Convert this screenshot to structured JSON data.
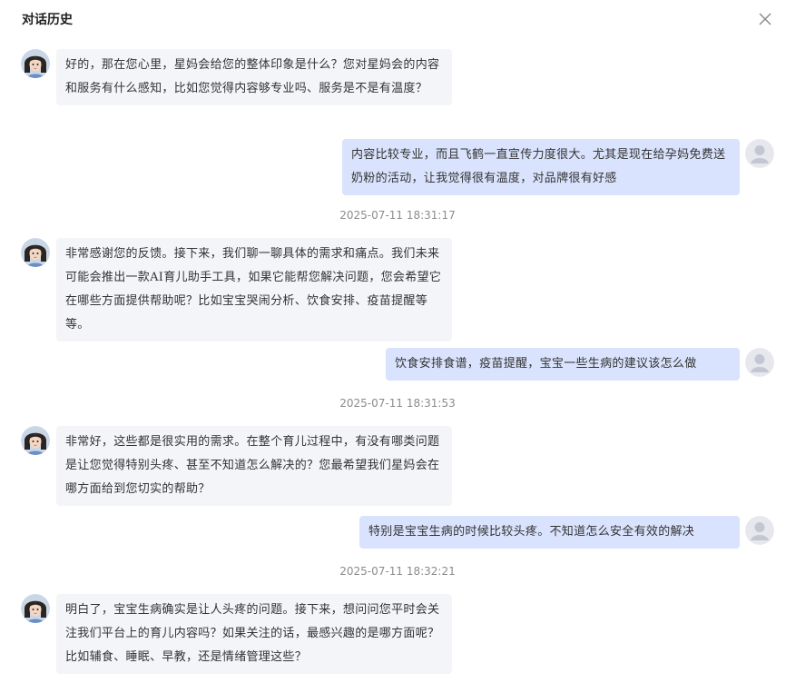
{
  "header": {
    "title": "对话历史"
  },
  "messages": [
    {
      "role": "ai",
      "text": "好的，那在您心里，星妈会给您的整体印象是什么？您对星妈会的内容和服务有什么感知，比如您觉得内容够专业吗、服务是不是有温度？"
    },
    {
      "role": "user",
      "text": "内容比较专业，而且飞鹤一直宣传力度很大。尤其是现在给孕妈免费送奶粉的活动，让我觉得很有温度，对品牌很有好感"
    },
    {
      "role": "ai",
      "text": "非常感谢您的反馈。接下来，我们聊一聊具体的需求和痛点。我们未来可能会推出一款AI育儿助手工具，如果它能帮您解决问题，您会希望它在哪些方面提供帮助呢？比如宝宝哭闹分析、饮食安排、疫苗提醒等等。"
    },
    {
      "role": "user",
      "text": "饮食安排食谱，疫苗提醒，宝宝一些生病的建议该怎么做"
    },
    {
      "role": "ai",
      "text": "非常好，这些都是很实用的需求。在整个育儿过程中，有没有哪类问题是让您觉得特别头疼、甚至不知道怎么解决的？您最希望我们星妈会在哪方面给到您切实的帮助？"
    },
    {
      "role": "user",
      "text": "特别是宝宝生病的时候比较头疼。不知道怎么安全有效的解决"
    },
    {
      "role": "ai",
      "text": "明白了，宝宝生病确实是让人头疼的问题。接下来，想问问您平时会关注我们平台上的育儿内容吗？如果关注的话，最感兴趣的是哪方面呢？比如辅食、睡眠、早教，还是情绪管理这些？"
    }
  ],
  "timestamps": [
    "2025-07-11 18:31:17",
    "2025-07-11 18:31:53",
    "2025-07-11 18:32:21"
  ],
  "icons": {
    "close": "close-icon",
    "ai_avatar": "assistant-avatar",
    "user_avatar": "user-avatar-icon"
  },
  "colors": {
    "ai_bubble": "#f4f5f9",
    "user_bubble": "#dae3fd",
    "timestamp": "#8c8c8c"
  }
}
